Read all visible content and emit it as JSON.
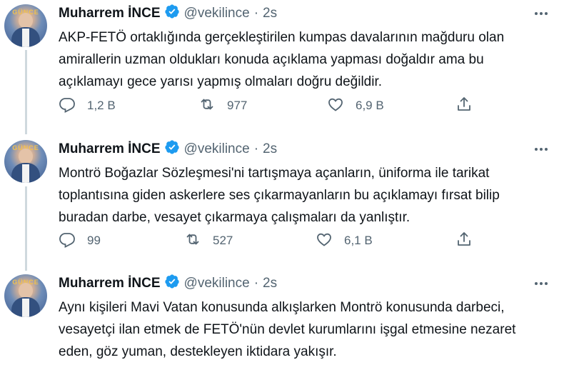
{
  "tweets": [
    {
      "name": "Muharrem İNCE",
      "handle": "@vekilince",
      "time": "2s",
      "avatar_text": "GÜNCE",
      "text": "AKP-FETÖ ortaklığında gerçekleştirilen kumpas davalarının mağduru olan amirallerin uzman oldukları konuda açıklama yapması doğaldır ama bu açıklamayı gece yarısı yapmış olmaları doğru değildir.",
      "replies": "1,2 B",
      "retweets": "977",
      "likes": "6,9 B"
    },
    {
      "name": "Muharrem İNCE",
      "handle": "@vekilince",
      "time": "2s",
      "avatar_text": "GÜNCE",
      "text": "Montrö Boğazlar Sözleşmesi'ni tartışmaya açanların, üniforma ile tarikat toplantısına giden askerlere ses çıkarmayanların bu açıklamayı fırsat bilip buradan darbe, vesayet çıkarmaya çalışmaları da yanlıştır.",
      "replies": "99",
      "retweets": "527",
      "likes": "6,1 B"
    },
    {
      "name": "Muharrem İNCE",
      "handle": "@vekilince",
      "time": "2s",
      "avatar_text": "GÜNCE",
      "text": "Aynı kişileri Mavi Vatan konusunda alkışlarken Montrö konusunda darbeci, vesayetçi ilan etmek de FETÖ'nün devlet kurumlarını işgal etmesine nezaret eden, göz yuman, destekleyen iktidara yakışır."
    }
  ],
  "separator": "·",
  "colors": {
    "verified": "#1d9bf0",
    "muted": "#536471",
    "text": "#0f1419",
    "thread_line": "#cfd9de"
  },
  "icons": [
    "verified-badge-icon",
    "more-icon",
    "reply-icon",
    "retweet-icon",
    "like-icon",
    "share-icon"
  ]
}
